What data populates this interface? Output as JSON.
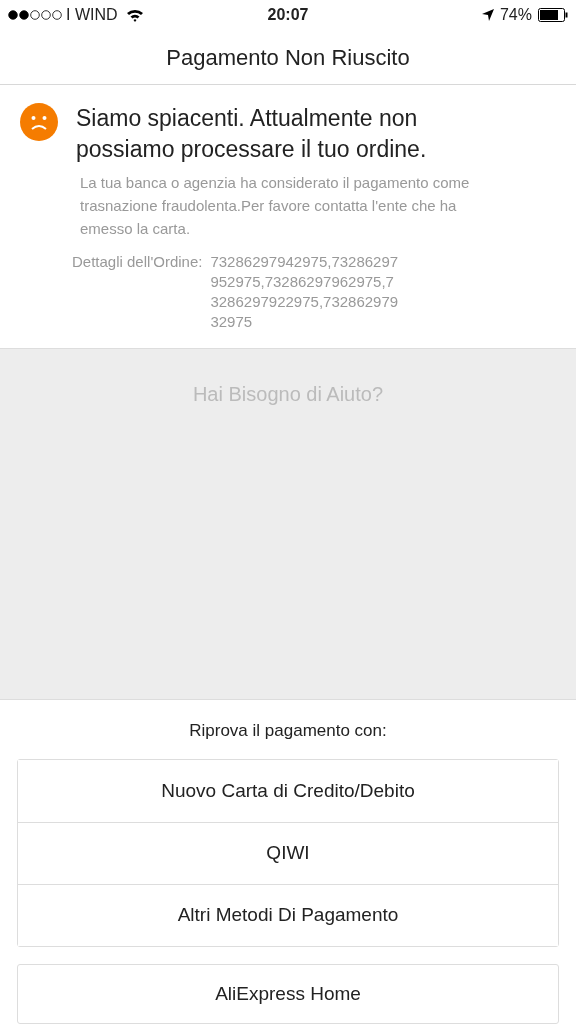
{
  "status_bar": {
    "carrier": "I WIND",
    "time": "20:07",
    "battery": "74%"
  },
  "nav": {
    "title": "Pagamento Non Riuscito"
  },
  "error": {
    "heading": "Siamo spiacenti. Attualmente non possiamo processare il tuo ordine.",
    "message": "La tua banca o agenzia ha considerato il pagamento come trasnazione fraudolenta.Per favore contatta l'ente che ha emesso la carta.",
    "details_label": "Dettagli dell'Ordine:",
    "details_value": "73286297942975,73286297952975,73286297962975,73286297922975,73286297932975"
  },
  "help": {
    "title": "Hai Bisogno di Aiuto?"
  },
  "retry": {
    "label": "Riprova il pagamento con:",
    "options": [
      "Nuovo Carta di Credito/Debito",
      "QIWI",
      "Altri Metodi Di Pagamento"
    ]
  },
  "home_button": "AliExpress Home"
}
